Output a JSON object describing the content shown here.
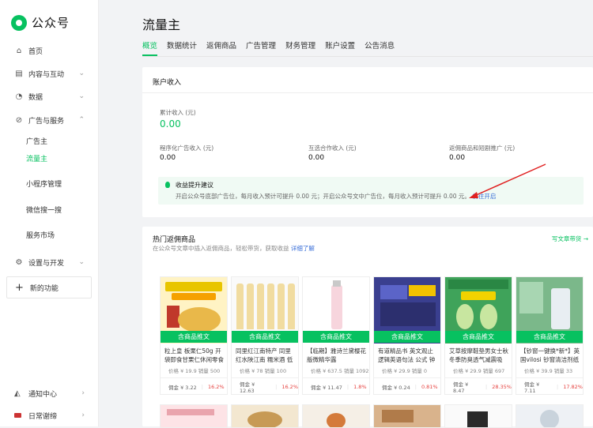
{
  "app": {
    "logo_text": "公众号"
  },
  "sidebar": {
    "items": [
      {
        "label": "首页",
        "icon": "home-icon"
      },
      {
        "label": "内容与互动",
        "icon": "document-icon"
      },
      {
        "label": "数据",
        "icon": "clock-icon"
      },
      {
        "label": "广告与服务",
        "icon": "compass-icon"
      },
      {
        "label": "设置与开发",
        "icon": "gear-icon"
      }
    ],
    "sub_items": [
      "广告主",
      "流量主",
      "小程序管理",
      "微信搜一搜",
      "服务市场"
    ],
    "new_function": "新的功能",
    "bottom": [
      {
        "label": "通知中心",
        "icon": "bell-icon"
      },
      {
        "label": "日常谢缔",
        "icon": "avatar-icon"
      }
    ]
  },
  "page": {
    "title": "流量主",
    "tabs": [
      "概览",
      "数据统计",
      "返佣商品",
      "广告管理",
      "财务管理",
      "账户设置",
      "公告消息"
    ]
  },
  "income": {
    "header": "账户收入",
    "total_label": "累计收入 (元)",
    "total_value": "0.00",
    "stats": [
      {
        "label": "程序化广告收入 (元)",
        "value": "0.00"
      },
      {
        "label": "互选合作收入 (元)",
        "value": "0.00"
      },
      {
        "label": "返佣商品和短剧推广 (元)",
        "value": "0.00"
      }
    ],
    "tip_title": "收益提升建议",
    "tip_text": "开启公众号底部广告位，每月收入预计可提升 0.00 元；开启公众号文中广告位，每月收入预计可提升 0.00 元。",
    "tip_link": "前往开启"
  },
  "hot": {
    "title": "热门返佣商品",
    "subtitle": "在公众号文章中插入返佣商品，轻松带货，获取收益",
    "subtitle_link": "详细了解",
    "write_link": "写文章带货 →",
    "tag": "含商品推文",
    "products": [
      {
        "name": "粒上皇 板栗仁50g 开袋即食甘栗仁休闲零食",
        "meta": "价格 ¥ 19.9  销量 500",
        "commission": "佣金 ¥ 3.22",
        "rate": "16.2%"
      },
      {
        "name": "同里红江南特产 同里红水陕江南 糯米酒 低度…",
        "meta": "价格 ¥ 78  销量 100",
        "commission": "佣金 ¥ 12.63",
        "rate": "16.2%"
      },
      {
        "name": "【临期】雅诗兰黛樱花版微精华露",
        "meta": "价格 ¥ 637.5  销量 1092",
        "commission": "佣金 ¥ 11.47",
        "rate": "1.8%"
      },
      {
        "name": "有道精品书 英文观止 逻辑英语句法 公式 钟平…",
        "meta": "价格 ¥ 29.9  销量 0",
        "commission": "佣金 ¥ 0.24",
        "rate": "0.81%"
      },
      {
        "name": "艾草按摩鞋垫男女士秋冬季防臭透气减震吸汗…",
        "meta": "价格 ¥ 29.9  销量 697",
        "commission": "佣金 ¥ 8.47",
        "rate": "28.35%"
      },
      {
        "name": "【钞窗一键换*新*】英国vilosi 钞窗清洁剂纸抹…",
        "meta": "价格 ¥ 39.9  销量 33",
        "commission": "佣金 ¥ 7.11",
        "rate": "17.82%"
      }
    ]
  },
  "colors": {
    "brand": "#07c160",
    "link": "#3a6fd8",
    "red": "#e64340",
    "arrow": "#e02020"
  }
}
